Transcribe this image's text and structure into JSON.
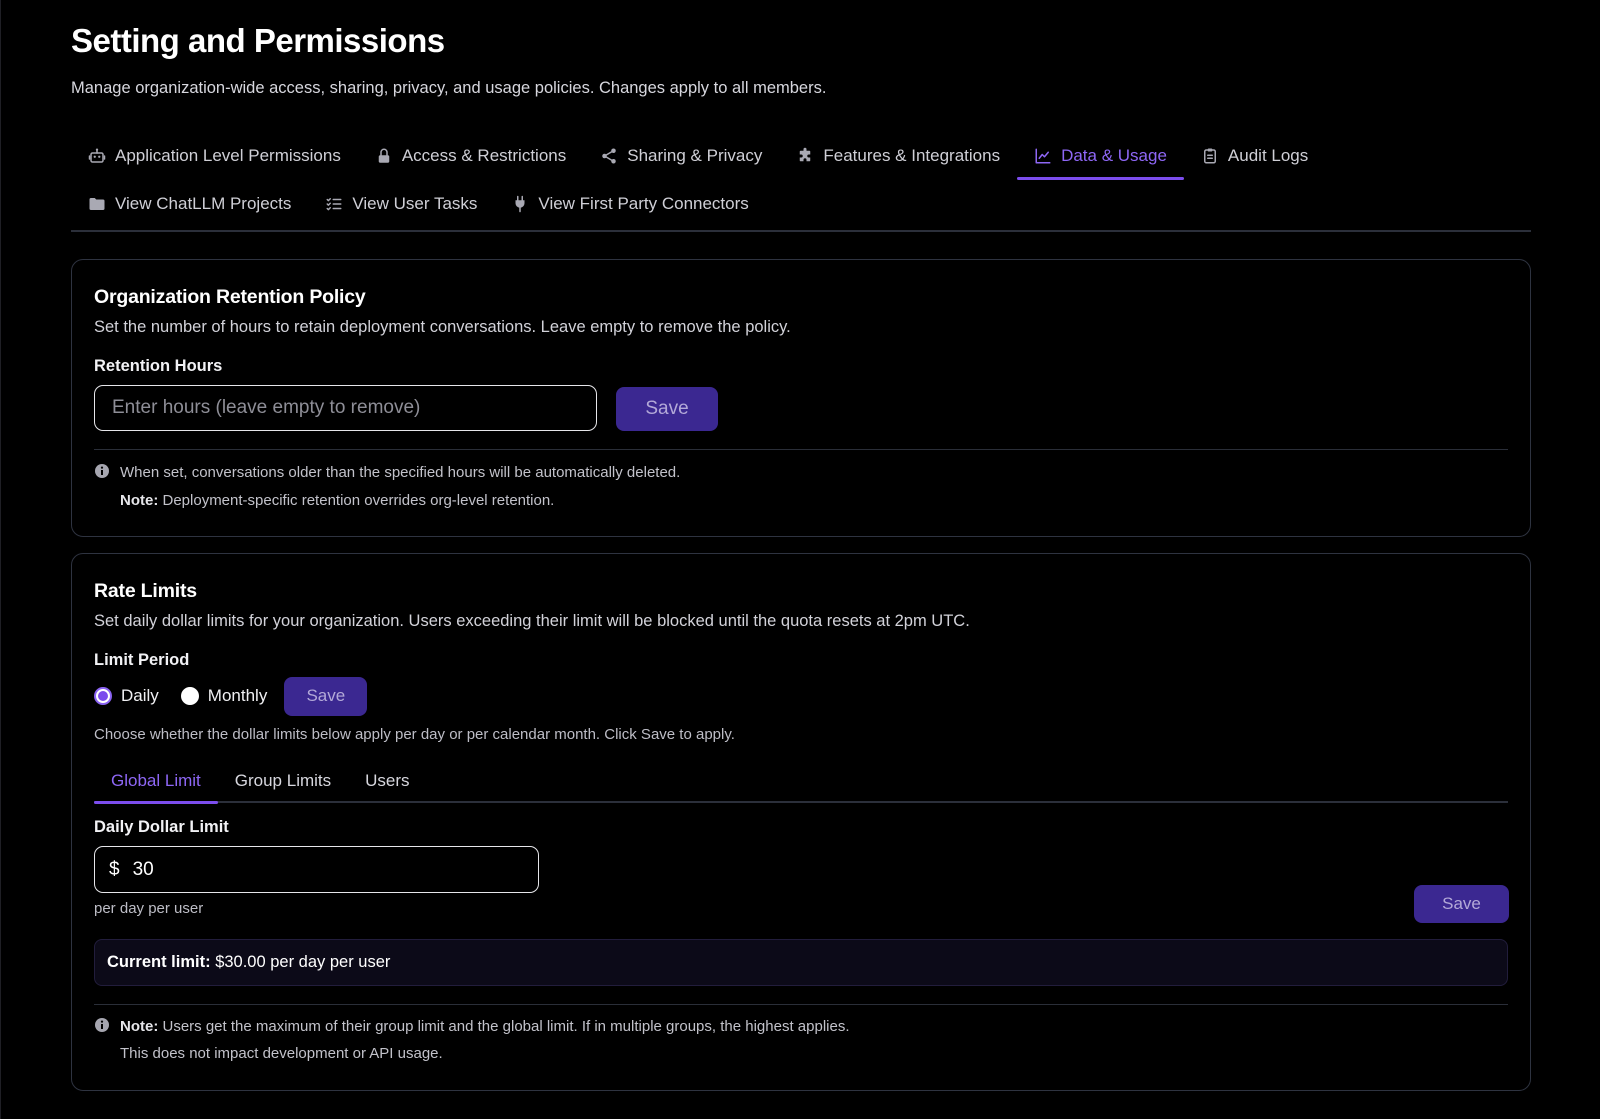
{
  "header": {
    "title": "Setting and Permissions",
    "subtitle": "Manage organization-wide access, sharing, privacy, and usage policies. Changes apply to all members."
  },
  "tabs": [
    {
      "label": "Application Level Permissions",
      "icon": "robot-icon"
    },
    {
      "label": "Access & Restrictions",
      "icon": "lock-icon"
    },
    {
      "label": "Sharing & Privacy",
      "icon": "share-icon"
    },
    {
      "label": "Features & Integrations",
      "icon": "puzzle-icon"
    },
    {
      "label": "Data & Usage",
      "icon": "line-chart-icon",
      "active": true
    },
    {
      "label": "Audit Logs",
      "icon": "clipboard-icon"
    },
    {
      "label": "View ChatLLM Projects",
      "icon": "folder-icon"
    },
    {
      "label": "View User Tasks",
      "icon": "list-check-icon"
    },
    {
      "label": "View First Party Connectors",
      "icon": "plug-icon"
    }
  ],
  "retention": {
    "title": "Organization Retention Policy",
    "description": "Set the number of hours to retain deployment conversations. Leave empty to remove the policy.",
    "field_label": "Retention Hours",
    "input_placeholder": "Enter hours (leave empty to remove)",
    "input_value": "",
    "save_label": "Save",
    "info_text": "When set, conversations older than the specified hours will be automatically deleted.",
    "note_label": "Note:",
    "note_text": "Deployment-specific retention overrides org-level retention."
  },
  "rate_limits": {
    "title": "Rate Limits",
    "description": "Set daily dollar limits for your organization. Users exceeding their limit will be blocked until the quota resets at 2pm UTC.",
    "period_label": "Limit Period",
    "period_options": [
      {
        "label": "Daily",
        "checked": true
      },
      {
        "label": "Monthly",
        "checked": false
      }
    ],
    "period_save_label": "Save",
    "period_help": "Choose whether the dollar limits below apply per day or per calendar month. Click Save to apply.",
    "sub_tabs": [
      {
        "label": "Global Limit",
        "active": true
      },
      {
        "label": "Group Limits",
        "active": false
      },
      {
        "label": "Users",
        "active": false
      }
    ],
    "limit_field_label": "Daily Dollar Limit",
    "currency_symbol": "$",
    "limit_value": "30",
    "limit_caption": "per day per user",
    "limit_save_label": "Save",
    "current_limit_label": "Current limit:",
    "current_limit_value": "$30.00 per day per user",
    "note_label": "Note:",
    "note_text": "Users get the maximum of their group limit and the global limit. If in multiple groups, the highest applies.",
    "note_text_2": "This does not impact development or API usage."
  },
  "colors": {
    "accent": "#8e67f5",
    "accent_bar": "#7c4dee",
    "save_button_bg": "#3b2891",
    "background": "#000000",
    "card_border": "#2e3340"
  }
}
